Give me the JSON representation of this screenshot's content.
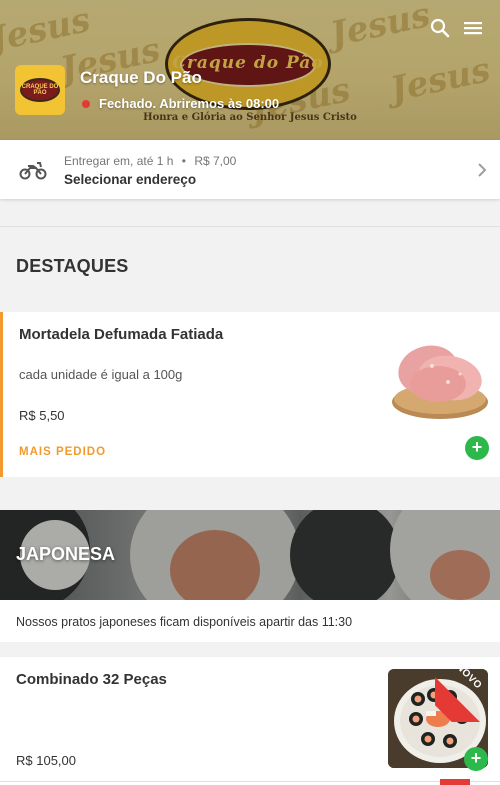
{
  "header": {
    "banner_logo_text": "Craque do Pão",
    "banner_tagline": "Honra e Glória ao Senhor Jesus Cristo",
    "banner_watermark": "Jesus",
    "store_logo_text": "CRAQUE DO PÃO",
    "store_name": "Craque Do Pão",
    "store_status": "Fechado. Abriremos às 08:00",
    "status_color": "#e53935"
  },
  "delivery": {
    "label": "Entregar em,",
    "time": "até 1 h",
    "separator": "•",
    "fee": "R$ 7,00",
    "address_cta": "Selecionar endereço"
  },
  "highlights": {
    "title": "DESTAQUES",
    "items": [
      {
        "name": "Mortadela Defumada Fatiada",
        "description": "cada unidade é igual a 100g",
        "price": "R$ 5,50",
        "badge": "MAIS PEDIDO",
        "add_label": "+"
      }
    ]
  },
  "category": {
    "title": "JAPONESA",
    "note": "Nossos pratos japoneses ficam disponíveis apartir das 11:30",
    "items": [
      {
        "name": "Combinado 32 Peças",
        "price": "R$ 105,00",
        "ribbon": "NOVO",
        "add_label": "+"
      }
    ]
  },
  "colors": {
    "accent_orange": "#f29a2e",
    "add_green": "#2db84b",
    "ribbon_red": "#e53935"
  },
  "icons": [
    "search-icon",
    "menu-icon",
    "motorcycle-icon",
    "chevron-right-icon",
    "status-dot-icon",
    "plus-icon"
  ]
}
